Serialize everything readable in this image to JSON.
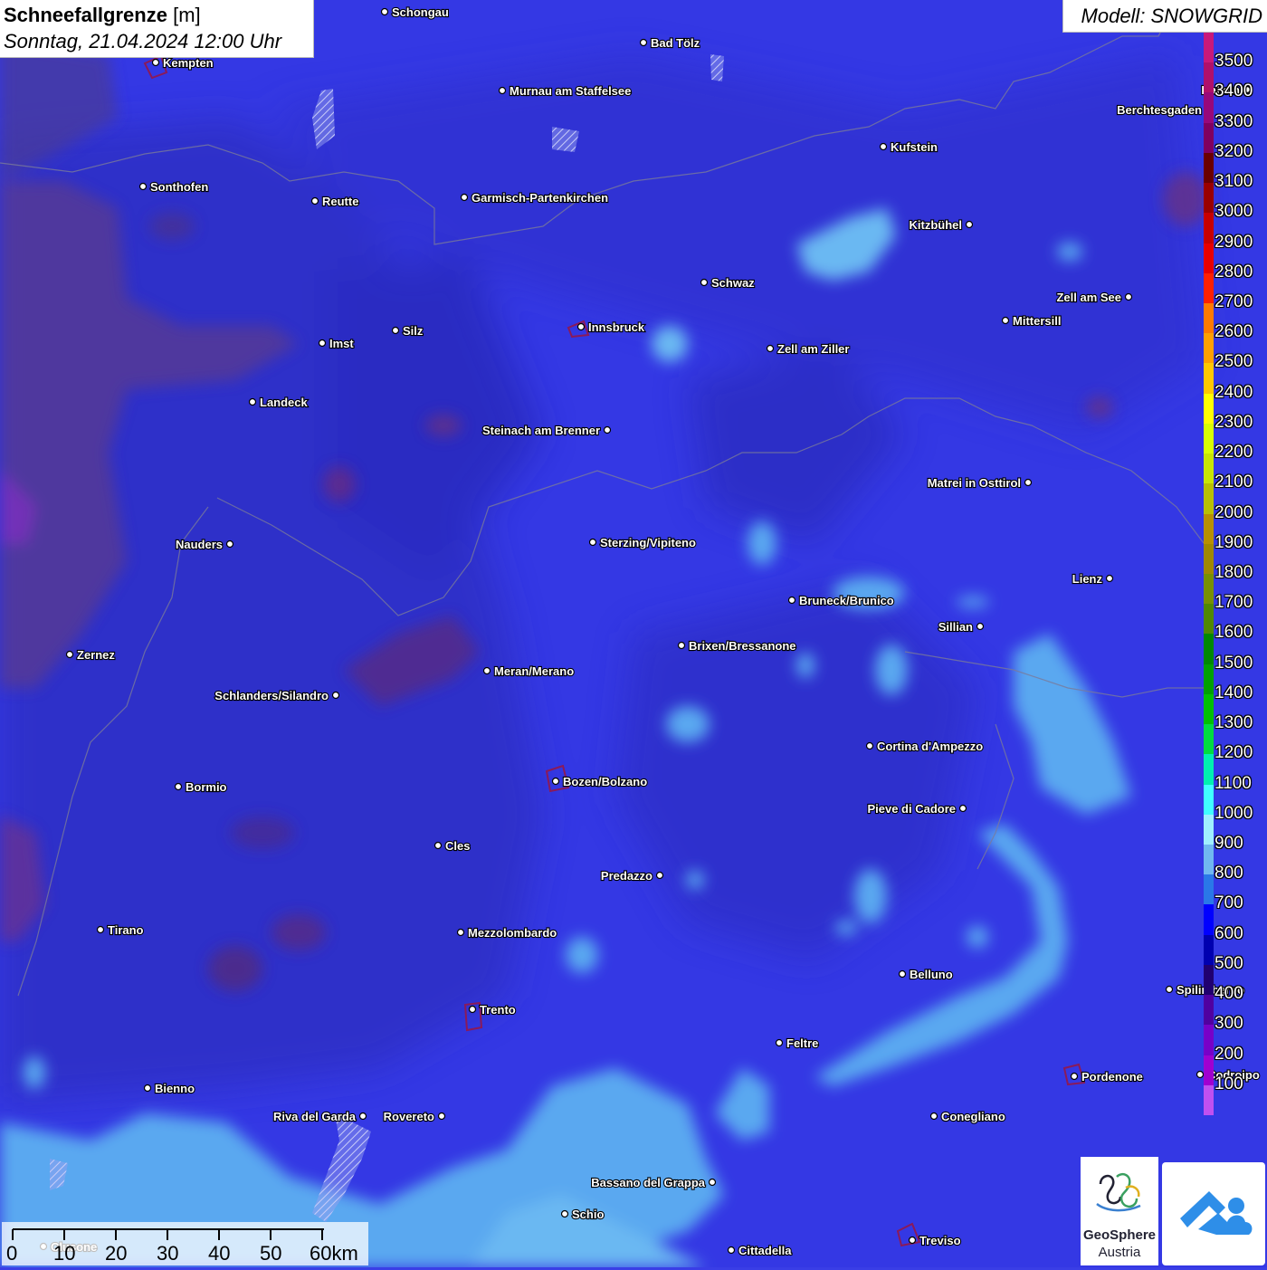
{
  "title": {
    "parameter": "Schneefallgrenze",
    "unit": "[m]",
    "datetime": "Sonntag, 21.04.2024 12:00 Uhr"
  },
  "model": "Modell: SNOWGRID",
  "legend": {
    "labels": [
      "3500",
      "3400",
      "3300",
      "3200",
      "3100",
      "3000",
      "2900",
      "2800",
      "2700",
      "2600",
      "2500",
      "2400",
      "2300",
      "2200",
      "2100",
      "2000",
      "1900",
      "1800",
      "1700",
      "1600",
      "1500",
      "1400",
      "1300",
      "1200",
      "1100",
      "1000",
      "900",
      "800",
      "700",
      "600",
      "500",
      "400",
      "300",
      "200",
      "100"
    ],
    "colors": [
      "#c8197a",
      "#b0106a",
      "#98087a",
      "#800060",
      "#6a0000",
      "#9a0000",
      "#c80000",
      "#e80000",
      "#ff2000",
      "#ff7a00",
      "#ffa000",
      "#ffc800",
      "#ffff00",
      "#d8ff00",
      "#c8e600",
      "#b8c000",
      "#b89000",
      "#a08800",
      "#789000",
      "#508800",
      "#008800",
      "#00a000",
      "#00c000",
      "#00dc40",
      "#00f0b0",
      "#40ffff",
      "#a0f0ff",
      "#70b8f0",
      "#2a78e8",
      "#0000ff",
      "#0000b0",
      "#200070",
      "#5000a0",
      "#7800c8",
      "#a000d0",
      "#c050f0"
    ]
  },
  "cities": [
    {
      "name": "Schongau",
      "label_side": "right"
    },
    {
      "name": "Kempten",
      "label_side": "right"
    },
    {
      "name": "Bad Tölz",
      "label_side": "right"
    },
    {
      "name": "Murnau am Staffelsee",
      "label_side": "right"
    },
    {
      "name": "Hallein",
      "label_side": "left"
    },
    {
      "name": "Berchtesgaden",
      "label_side": "left"
    },
    {
      "name": "Kufstein",
      "label_side": "right"
    },
    {
      "name": "Sonthofen",
      "label_side": "right"
    },
    {
      "name": "Reutte",
      "label_side": "right"
    },
    {
      "name": "Garmisch-Partenkirchen",
      "label_side": "right"
    },
    {
      "name": "Kitzbühel",
      "label_side": "left"
    },
    {
      "name": "Schwaz",
      "label_side": "right"
    },
    {
      "name": "Zell am See",
      "label_side": "left"
    },
    {
      "name": "Innsbruck",
      "label_side": "right"
    },
    {
      "name": "Imst",
      "label_side": "right"
    },
    {
      "name": "Silz",
      "label_side": "right"
    },
    {
      "name": "Mittersill",
      "label_side": "right"
    },
    {
      "name": "Zell am Ziller",
      "label_side": "right"
    },
    {
      "name": "Landeck",
      "label_side": "right"
    },
    {
      "name": "Steinach am Brenner",
      "label_side": "left"
    },
    {
      "name": "Matrei in Osttirol",
      "label_side": "left"
    },
    {
      "name": "Nauders",
      "label_side": "left"
    },
    {
      "name": "Sterzing/Vipiteno",
      "label_side": "right"
    },
    {
      "name": "Lienz",
      "label_side": "left"
    },
    {
      "name": "Bruneck/Brunico",
      "label_side": "right"
    },
    {
      "name": "Sillian",
      "label_side": "left"
    },
    {
      "name": "Brixen/Bressanone",
      "label_side": "right"
    },
    {
      "name": "Zernez",
      "label_side": "right"
    },
    {
      "name": "Meran/Merano",
      "label_side": "right"
    },
    {
      "name": "Schlanders/Silandro",
      "label_side": "left"
    },
    {
      "name": "Cortina d'Ampezzo",
      "label_side": "right"
    },
    {
      "name": "Bozen/Bolzano",
      "label_side": "right"
    },
    {
      "name": "Bormio",
      "label_side": "right"
    },
    {
      "name": "Pieve di Cadore",
      "label_side": "left"
    },
    {
      "name": "Cles",
      "label_side": "right"
    },
    {
      "name": "Predazzo",
      "label_side": "left"
    },
    {
      "name": "Tirano",
      "label_side": "right"
    },
    {
      "name": "Mezzolombardo",
      "label_side": "right"
    },
    {
      "name": "Belluno",
      "label_side": "right"
    },
    {
      "name": "Spilimbergo",
      "label_side": "right"
    },
    {
      "name": "Trento",
      "label_side": "right"
    },
    {
      "name": "Feltre",
      "label_side": "right"
    },
    {
      "name": "Pordenone",
      "label_side": "right"
    },
    {
      "name": "Codroipo",
      "label_side": "right"
    },
    {
      "name": "Bienno",
      "label_side": "right"
    },
    {
      "name": "Riva del Garda",
      "label_side": "left"
    },
    {
      "name": "Rovereto",
      "label_side": "left"
    },
    {
      "name": "Conegliano",
      "label_side": "right"
    },
    {
      "name": "Bassano del Grappa",
      "label_side": "left"
    },
    {
      "name": "Schio",
      "label_side": "right"
    },
    {
      "name": "Cittadella",
      "label_side": "right"
    },
    {
      "name": "Treviso",
      "label_side": "right"
    },
    {
      "name": "Clusone",
      "label_side": "right"
    }
  ],
  "scale": {
    "labels": [
      "0",
      "10",
      "20",
      "30",
      "40",
      "50",
      "60km"
    ]
  },
  "logos": {
    "geosphere_name": "GeoSphere",
    "geosphere_sub": "Austria"
  }
}
